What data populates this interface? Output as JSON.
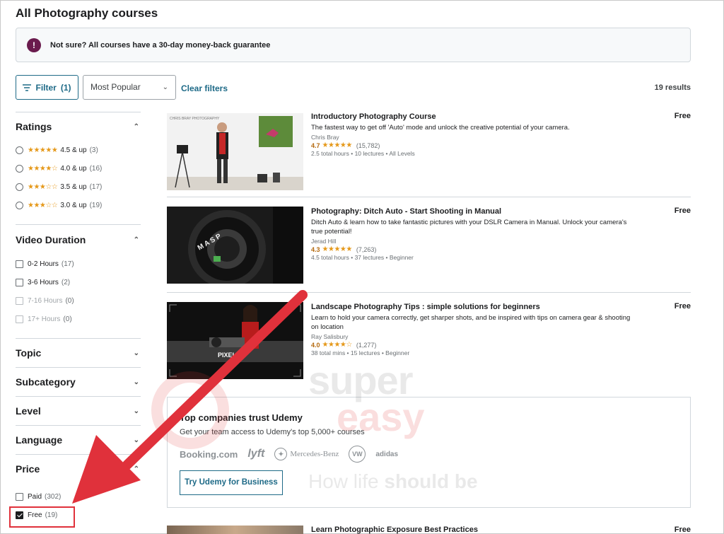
{
  "page": {
    "title": "All Photography courses"
  },
  "banner": {
    "icon": "info-icon",
    "text": "Not sure? All courses have a 30-day money-back guarantee"
  },
  "toolbar": {
    "filter_label": "Filter",
    "filter_count": "(1)",
    "sort_value": "Most Popular",
    "clear_filters": "Clear filters",
    "results": "19 results"
  },
  "sidebar": {
    "ratings": {
      "title": "Ratings",
      "options": [
        {
          "stars": "★★★★★",
          "label": "4.5 & up",
          "count": "(3)"
        },
        {
          "stars": "★★★★☆",
          "label": "4.0 & up",
          "count": "(16)"
        },
        {
          "stars": "★★★☆☆",
          "label": "3.5 & up",
          "count": "(17)"
        },
        {
          "stars": "★★★☆☆",
          "label": "3.0 & up",
          "count": "(19)"
        }
      ]
    },
    "duration": {
      "title": "Video Duration",
      "options": [
        {
          "label": "0-2 Hours",
          "count": "(17)"
        },
        {
          "label": "3-6 Hours",
          "count": "(2)"
        },
        {
          "label": "7-16 Hours",
          "count": "(0)"
        },
        {
          "label": "17+ Hours",
          "count": "(0)"
        }
      ]
    },
    "topic": {
      "title": "Topic"
    },
    "subcategory": {
      "title": "Subcategory"
    },
    "level": {
      "title": "Level"
    },
    "language": {
      "title": "Language"
    },
    "price": {
      "title": "Price",
      "options": [
        {
          "label": "Paid",
          "count": "(302)",
          "checked": false
        },
        {
          "label": "Free",
          "count": "(19)",
          "checked": true
        }
      ]
    }
  },
  "courses": [
    {
      "title": "Introductory Photography Course",
      "desc": "The fastest way to get off 'Auto' mode and unlock the creative potential of your camera.",
      "author": "Chris Bray",
      "rating": "4.7",
      "stars": "★★★★★",
      "reviews": "(15,782)",
      "meta": "2.5 total hours • 10 lectures • All Levels",
      "price": "Free",
      "thumb_text": "CHRIS BRAY PHOTOGRAPHY"
    },
    {
      "title": "Photography: Ditch Auto - Start Shooting in Manual",
      "desc": "Ditch Auto & learn how to take fantastic pictures with your DSLR Camera in Manual. Unlock your camera's true potential!",
      "author": "Jerad Hill",
      "rating": "4.3",
      "stars": "★★★★★",
      "reviews": "(7,263)",
      "meta": "4.5 total hours • 37 lectures • Beginner",
      "price": "Free",
      "thumb_text": "M A S P"
    },
    {
      "title": "Landscape Photography Tips : simple solutions for beginners",
      "desc": "Learn to hold your camera correctly, get sharper shots, and be inspired with tips on camera gear & shooting on location",
      "author": "Ray Salisbury",
      "rating": "4.0",
      "stars": "★★★★☆",
      "reviews": "(1,277)",
      "meta": "38 total mins • 15 lectures • Beginner",
      "price": "Free",
      "thumb_text": "PIXEL"
    }
  ],
  "trust": {
    "title": "Top companies trust Udemy",
    "subtitle": "Get your team access to Udemy's top 5,000+ courses",
    "logos": [
      "Booking.com",
      "lyft",
      "Mercedes-Benz",
      "VW",
      "adidas"
    ],
    "button": "Try Udemy for Business"
  },
  "next_course": {
    "title": "Learn Photographic Exposure Best Practices",
    "price": "Free"
  },
  "watermark": {
    "line1": "super",
    "line2": "easy",
    "tagline_a": "How life ",
    "tagline_b": "should be"
  },
  "colors": {
    "accent": "#1e6a87",
    "star": "#e59819",
    "rating_text": "#b4690e",
    "arrow": "#e0313b",
    "banner_icon": "#6a1b4d"
  }
}
